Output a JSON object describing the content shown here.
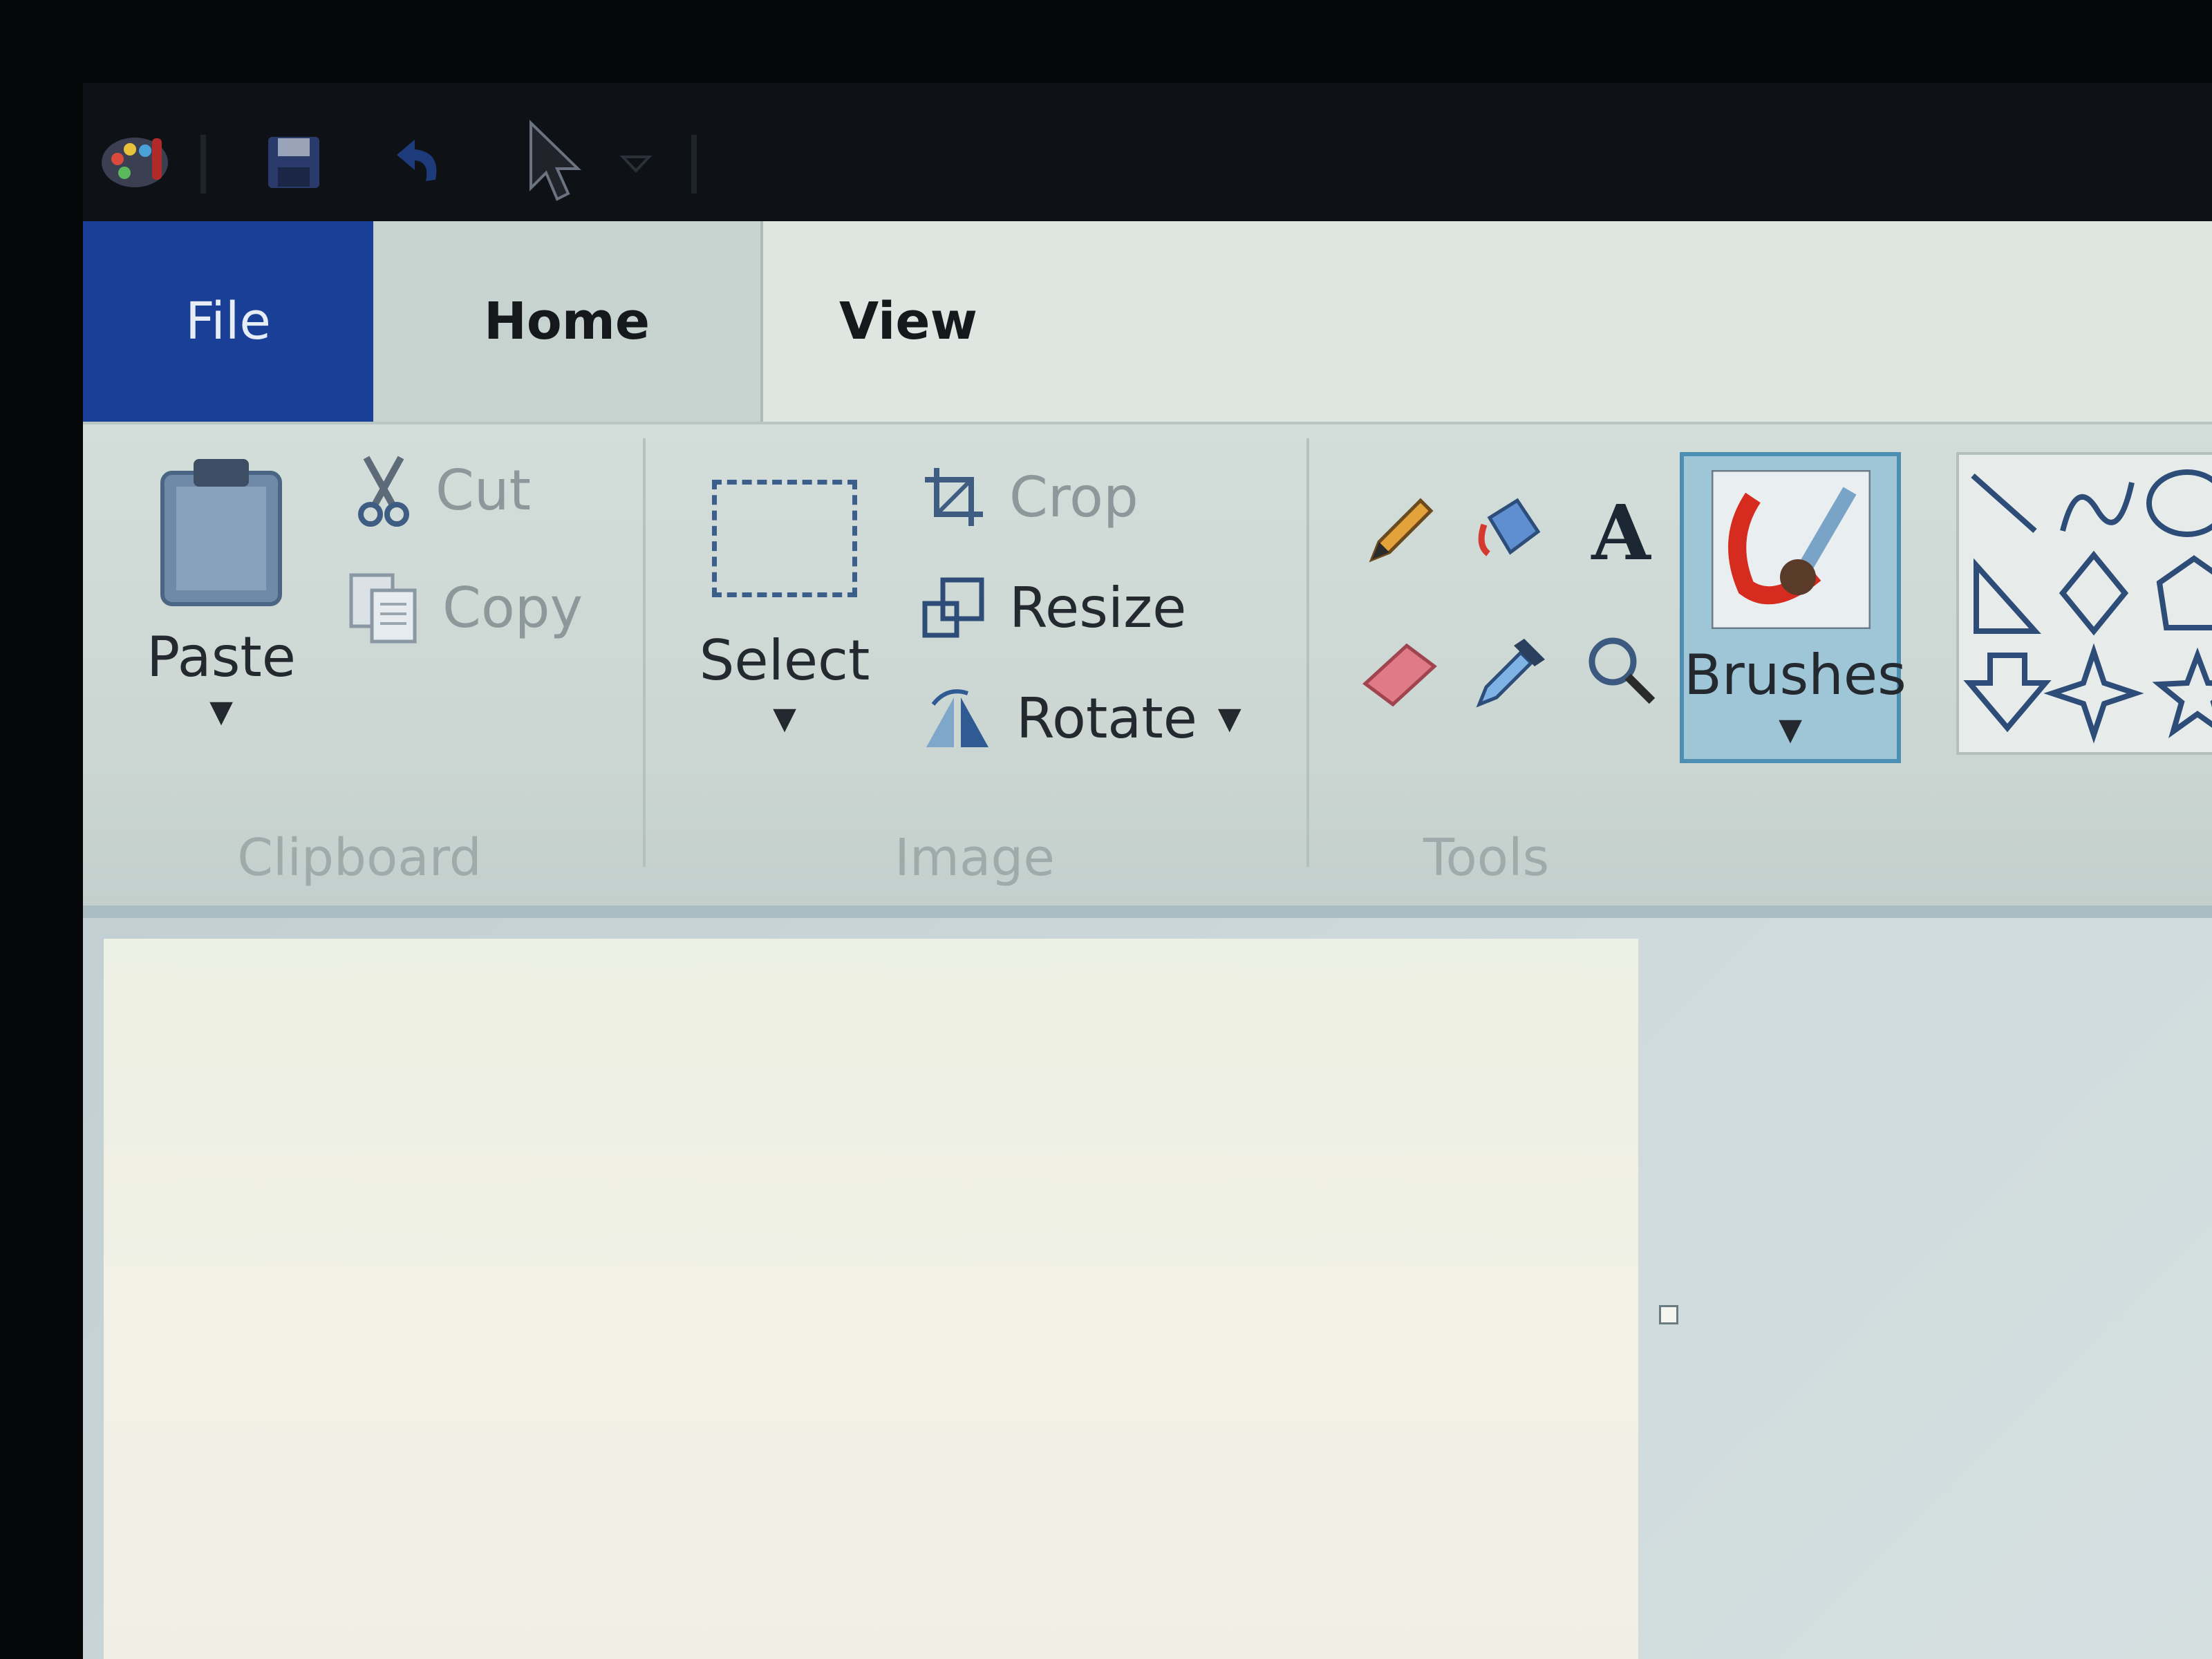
{
  "quick_access": {
    "icons": [
      "paint-app-icon",
      "save-icon",
      "undo-icon",
      "redo-icon",
      "customize-dropdown-icon"
    ]
  },
  "tabs": {
    "file": "File",
    "home": "Home",
    "view": "View"
  },
  "clipboard": {
    "paste": "Paste",
    "cut": "Cut",
    "copy": "Copy",
    "group_label": "Clipboard"
  },
  "image": {
    "select": "Select",
    "crop": "Crop",
    "resize": "Resize",
    "rotate": "Rotate",
    "group_label": "Image"
  },
  "tools": {
    "items": [
      "pencil-icon",
      "fill-bucket-icon",
      "text-icon",
      "eraser-icon",
      "color-picker-icon",
      "magnifier-icon"
    ],
    "group_label": "Tools"
  },
  "brushes": {
    "label": "Brushes"
  },
  "shapes": {
    "items": [
      "line",
      "curve",
      "oval",
      "triangle",
      "diamond",
      "pentagon",
      "down-arrow",
      "four-point-star",
      "five-point-star"
    ]
  },
  "colors": {
    "file_tab": "#193f96",
    "brushes_highlight": "#9fc6d6",
    "canvas": "#f0efe6"
  }
}
